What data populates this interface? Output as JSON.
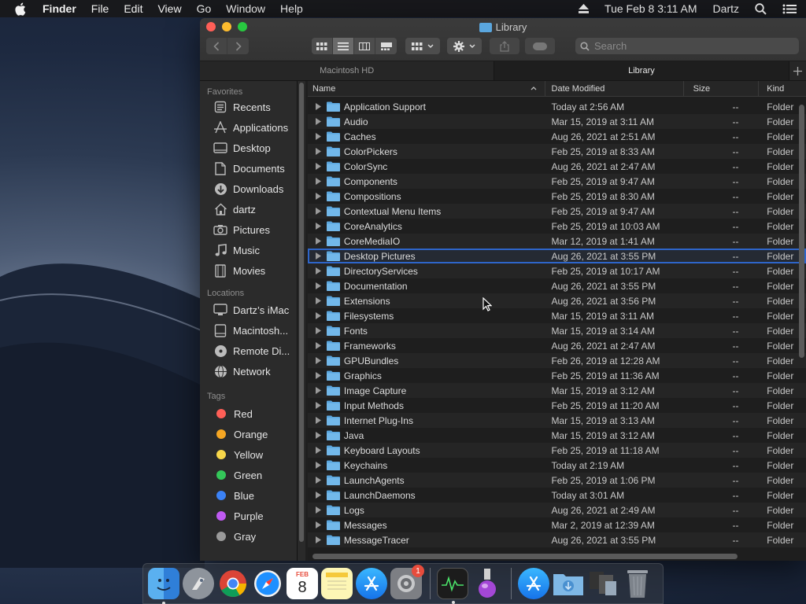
{
  "menubar": {
    "app": "Finder",
    "items": [
      "File",
      "Edit",
      "View",
      "Go",
      "Window",
      "Help"
    ],
    "clock": "Tue Feb 8  3:11 AM",
    "user": "Dartz"
  },
  "window": {
    "title": "Library",
    "search_placeholder": "Search",
    "path_tabs": [
      {
        "label": "Macintosh HD",
        "active": false
      },
      {
        "label": "Library",
        "active": true
      }
    ]
  },
  "sidebar": {
    "favorites_label": "Favorites",
    "favorites": [
      {
        "label": "Recents",
        "icon": "clock-icon"
      },
      {
        "label": "Applications",
        "icon": "applications-icon"
      },
      {
        "label": "Desktop",
        "icon": "desktop-icon"
      },
      {
        "label": "Documents",
        "icon": "document-icon"
      },
      {
        "label": "Downloads",
        "icon": "download-icon"
      },
      {
        "label": "dartz",
        "icon": "home-icon"
      },
      {
        "label": "Pictures",
        "icon": "camera-icon"
      },
      {
        "label": "Music",
        "icon": "music-note-icon"
      },
      {
        "label": "Movies",
        "icon": "film-icon"
      }
    ],
    "locations_label": "Locations",
    "locations": [
      {
        "label": "Dartz’s iMac",
        "icon": "imac-icon"
      },
      {
        "label": "Macintosh...",
        "icon": "hard-drive-icon"
      },
      {
        "label": "Remote Di...",
        "icon": "disc-icon"
      },
      {
        "label": "Network",
        "icon": "globe-icon"
      }
    ],
    "tags_label": "Tags",
    "tags": [
      {
        "label": "Red",
        "color": "#ff5f57"
      },
      {
        "label": "Orange",
        "color": "#f5a623"
      },
      {
        "label": "Yellow",
        "color": "#f8d74a"
      },
      {
        "label": "Green",
        "color": "#34c759"
      },
      {
        "label": "Blue",
        "color": "#3b82f6"
      },
      {
        "label": "Purple",
        "color": "#bf5af2"
      },
      {
        "label": "Gray",
        "color": "#9a9a9a"
      }
    ]
  },
  "columns": {
    "name": "Name",
    "date": "Date Modified",
    "size": "Size",
    "kind": "Kind"
  },
  "files": [
    {
      "name": "Application Support",
      "date": "Today at 2:56 AM",
      "size": "--",
      "kind": "Folder"
    },
    {
      "name": "Audio",
      "date": "Mar 15, 2019 at 3:11 AM",
      "size": "--",
      "kind": "Folder"
    },
    {
      "name": "Caches",
      "date": "Aug 26, 2021 at 2:51 AM",
      "size": "--",
      "kind": "Folder"
    },
    {
      "name": "ColorPickers",
      "date": "Feb 25, 2019 at 8:33 AM",
      "size": "--",
      "kind": "Folder"
    },
    {
      "name": "ColorSync",
      "date": "Aug 26, 2021 at 2:47 AM",
      "size": "--",
      "kind": "Folder"
    },
    {
      "name": "Components",
      "date": "Feb 25, 2019 at 9:47 AM",
      "size": "--",
      "kind": "Folder"
    },
    {
      "name": "Compositions",
      "date": "Feb 25, 2019 at 8:30 AM",
      "size": "--",
      "kind": "Folder"
    },
    {
      "name": "Contextual Menu Items",
      "date": "Feb 25, 2019 at 9:47 AM",
      "size": "--",
      "kind": "Folder"
    },
    {
      "name": "CoreAnalytics",
      "date": "Feb 25, 2019 at 10:03 AM",
      "size": "--",
      "kind": "Folder"
    },
    {
      "name": "CoreMediaIO",
      "date": "Mar 12, 2019 at 1:41 AM",
      "size": "--",
      "kind": "Folder"
    },
    {
      "name": "Desktop Pictures",
      "date": "Aug 26, 2021 at 3:55 PM",
      "size": "--",
      "kind": "Folder",
      "selected": true
    },
    {
      "name": "DirectoryServices",
      "date": "Feb 25, 2019 at 10:17 AM",
      "size": "--",
      "kind": "Folder"
    },
    {
      "name": "Documentation",
      "date": "Aug 26, 2021 at 3:55 PM",
      "size": "--",
      "kind": "Folder"
    },
    {
      "name": "Extensions",
      "date": "Aug 26, 2021 at 3:56 PM",
      "size": "--",
      "kind": "Folder"
    },
    {
      "name": "Filesystems",
      "date": "Mar 15, 2019 at 3:11 AM",
      "size": "--",
      "kind": "Folder"
    },
    {
      "name": "Fonts",
      "date": "Mar 15, 2019 at 3:14 AM",
      "size": "--",
      "kind": "Folder"
    },
    {
      "name": "Frameworks",
      "date": "Aug 26, 2021 at 2:47 AM",
      "size": "--",
      "kind": "Folder"
    },
    {
      "name": "GPUBundles",
      "date": "Feb 26, 2019 at 12:28 AM",
      "size": "--",
      "kind": "Folder"
    },
    {
      "name": "Graphics",
      "date": "Feb 25, 2019 at 11:36 AM",
      "size": "--",
      "kind": "Folder"
    },
    {
      "name": "Image Capture",
      "date": "Mar 15, 2019 at 3:12 AM",
      "size": "--",
      "kind": "Folder"
    },
    {
      "name": "Input Methods",
      "date": "Feb 25, 2019 at 11:20 AM",
      "size": "--",
      "kind": "Folder"
    },
    {
      "name": "Internet Plug-Ins",
      "date": "Mar 15, 2019 at 3:13 AM",
      "size": "--",
      "kind": "Folder"
    },
    {
      "name": "Java",
      "date": "Mar 15, 2019 at 3:12 AM",
      "size": "--",
      "kind": "Folder"
    },
    {
      "name": "Keyboard Layouts",
      "date": "Feb 25, 2019 at 11:18 AM",
      "size": "--",
      "kind": "Folder"
    },
    {
      "name": "Keychains",
      "date": "Today at 2:19 AM",
      "size": "--",
      "kind": "Folder"
    },
    {
      "name": "LaunchAgents",
      "date": "Feb 25, 2019 at 1:06 PM",
      "size": "--",
      "kind": "Folder"
    },
    {
      "name": "LaunchDaemons",
      "date": "Today at 3:01 AM",
      "size": "--",
      "kind": "Folder"
    },
    {
      "name": "Logs",
      "date": "Aug 26, 2021 at 2:49 AM",
      "size": "--",
      "kind": "Folder"
    },
    {
      "name": "Messages",
      "date": "Mar 2, 2019 at 12:39 AM",
      "size": "--",
      "kind": "Folder"
    },
    {
      "name": "MessageTracer",
      "date": "Aug 26, 2021 at 3:55 PM",
      "size": "--",
      "kind": "Folder"
    }
  ],
  "dock": {
    "calendar_month": "FEB",
    "calendar_day": "8",
    "settings_badge": "1",
    "apps": [
      "finder-icon",
      "launchpad-icon",
      "chrome-icon",
      "safari-icon",
      "calendar-icon",
      "notes-icon",
      "app-store-icon",
      "system-preferences-icon",
      "activity-monitor-icon",
      "installer-icon",
      "app-store-folder-icon",
      "downloads-folder-icon",
      "documents-stack-icon",
      "trash-icon"
    ]
  }
}
